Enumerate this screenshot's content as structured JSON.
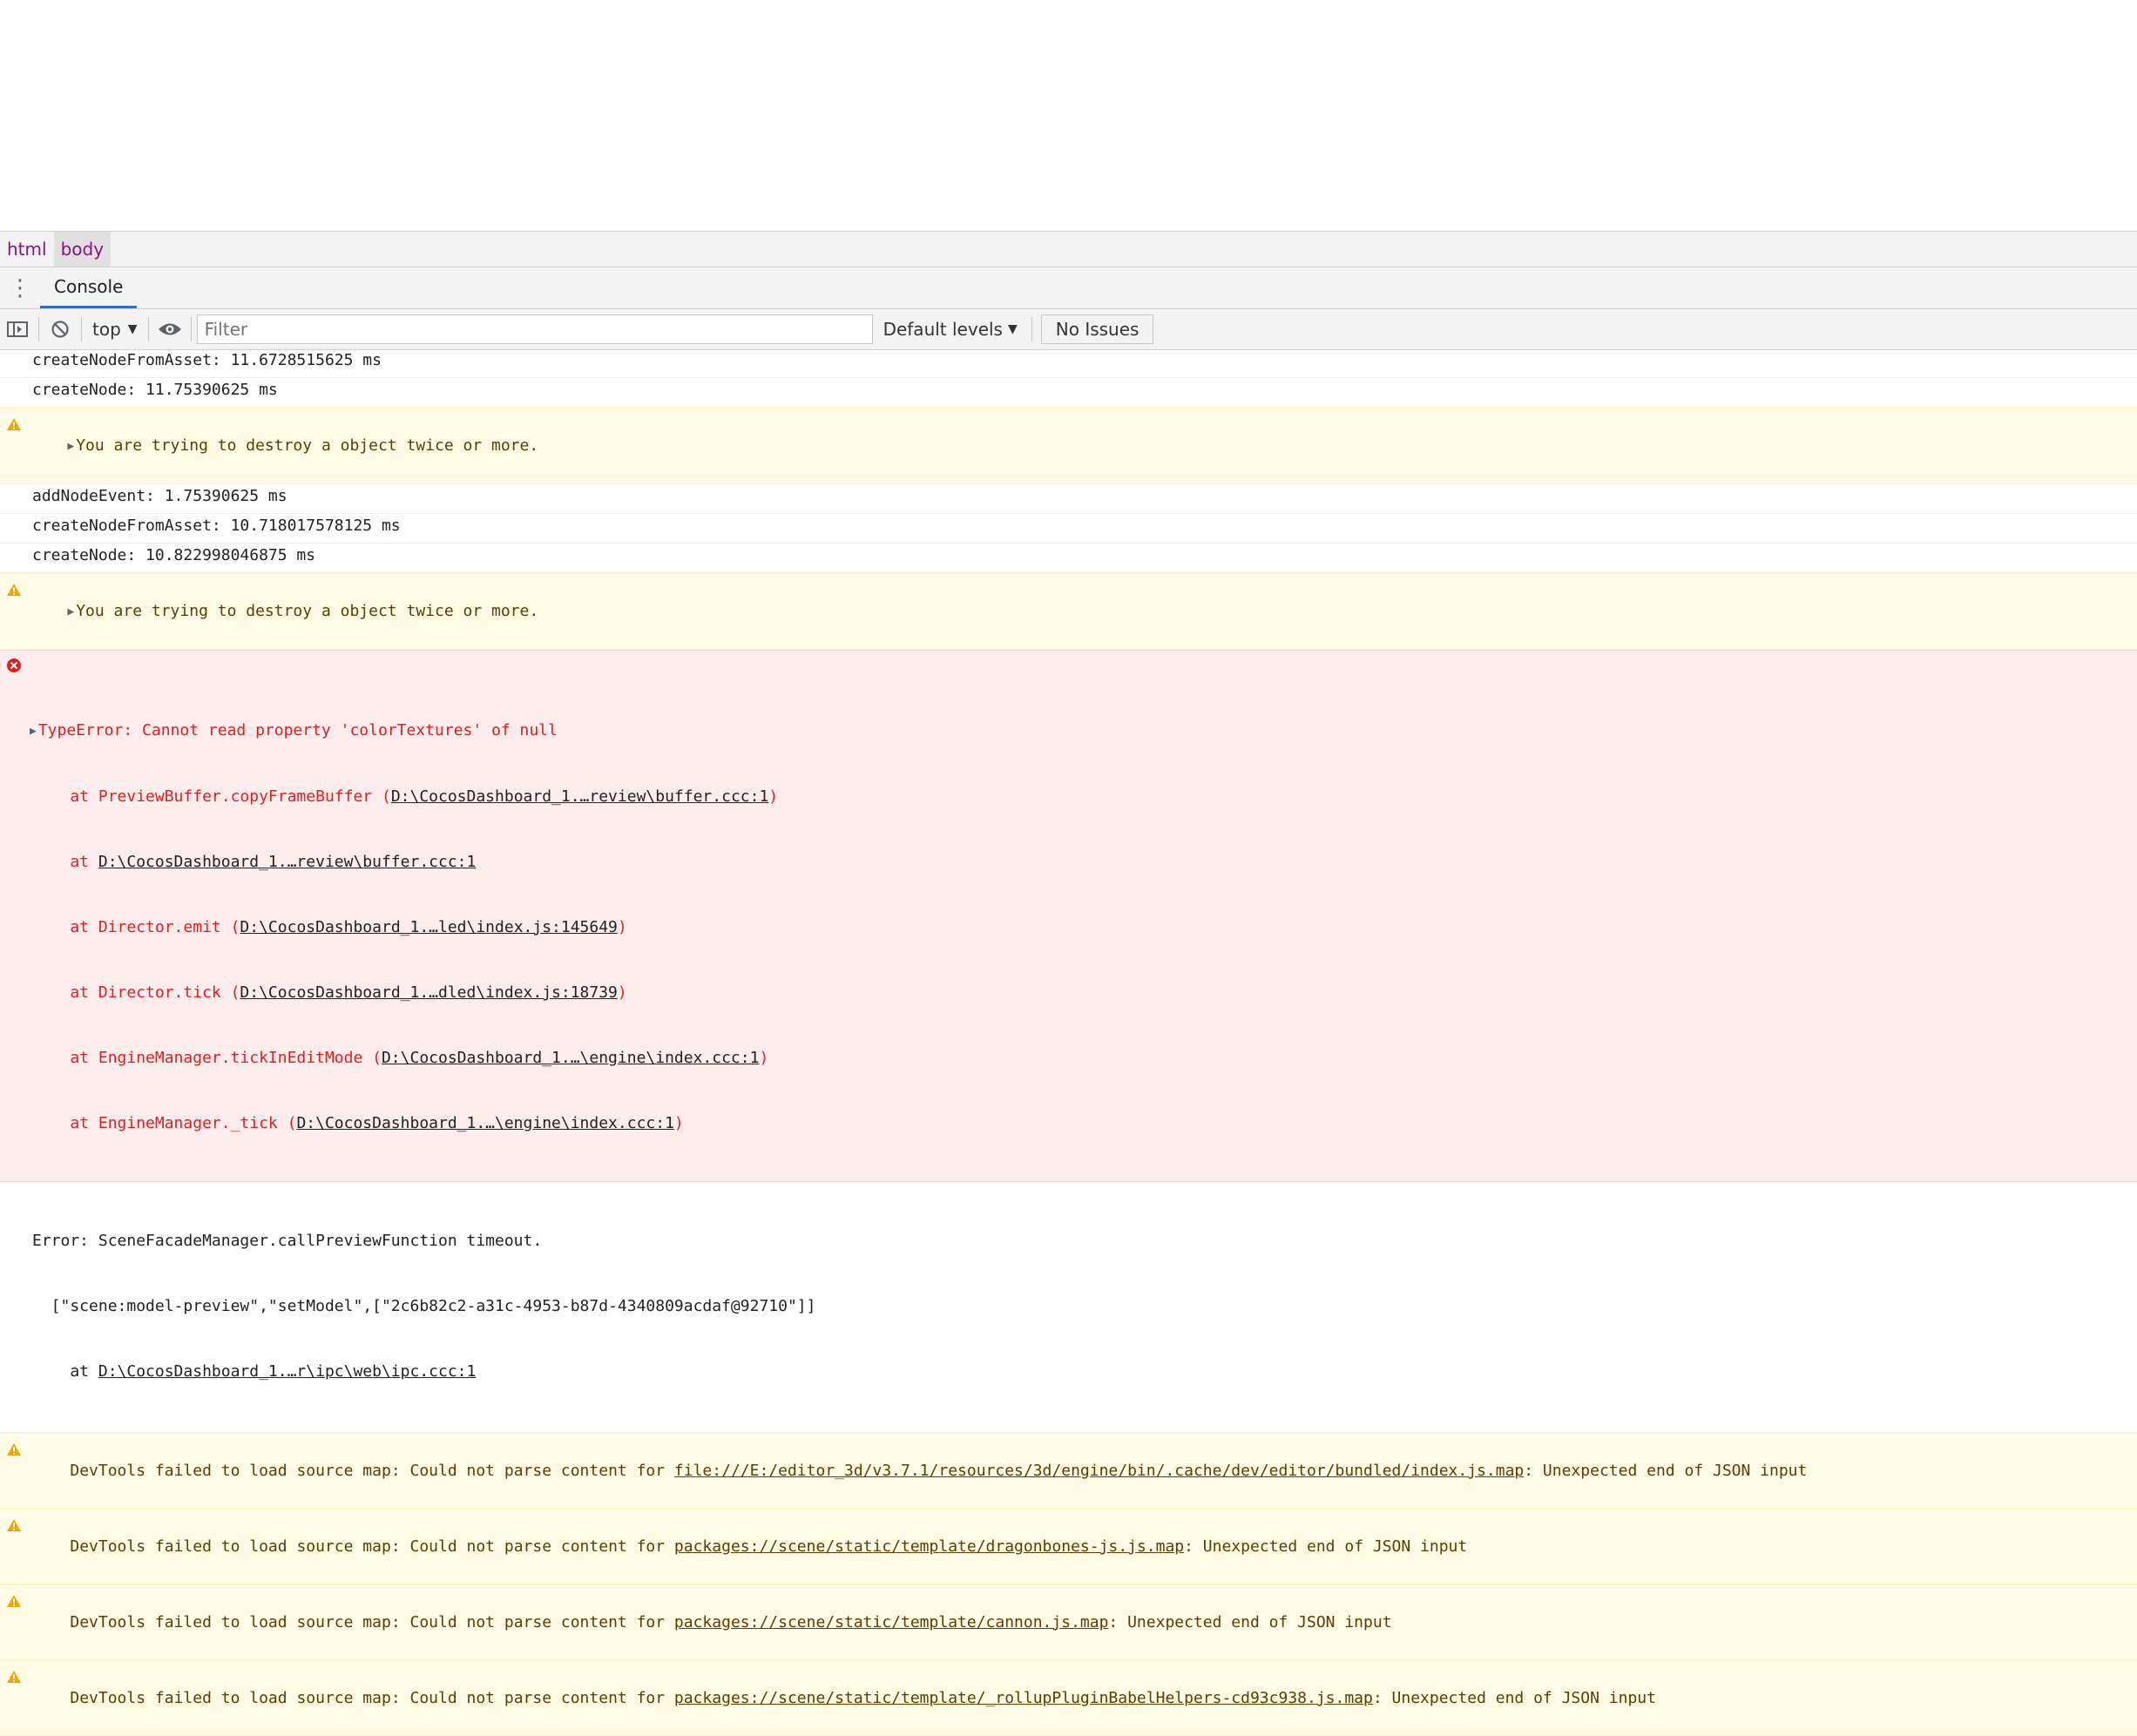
{
  "breadcrumb": [
    "html",
    "body"
  ],
  "drawer": {
    "tab": "Console"
  },
  "toolbar": {
    "context": "top",
    "filter_placeholder": "Filter",
    "levels": "Default levels",
    "issues": "No Issues"
  },
  "messages": [
    {
      "type": "log",
      "text": "createNodeFromAsset: 11.6728515625 ms"
    },
    {
      "type": "log",
      "text": "createNode: 11.75390625 ms"
    },
    {
      "type": "warn",
      "text": "You are trying to destroy a object twice or more."
    },
    {
      "type": "log",
      "text": "addNodeEvent: 1.75390625 ms"
    },
    {
      "type": "log",
      "text": "createNodeFromAsset: 10.718017578125 ms"
    },
    {
      "type": "log",
      "text": "createNode: 10.822998046875 ms"
    },
    {
      "type": "warn",
      "text": "You are trying to destroy a object twice or more."
    }
  ],
  "error": {
    "title": "TypeError: Cannot read property 'colorTextures' of null",
    "stack": [
      {
        "pre": "    at PreviewBuffer.copyFrameBuffer (",
        "link": "D:\\CocosDashboard_1.…review\\buffer.ccc:1",
        "post": ")"
      },
      {
        "pre": "    at ",
        "link": "D:\\CocosDashboard_1.…review\\buffer.ccc:1",
        "post": ""
      },
      {
        "pre": "    at Director.emit (",
        "link": "D:\\CocosDashboard_1.…led\\index.js:145649",
        "post": ")"
      },
      {
        "pre": "    at Director.tick (",
        "link": "D:\\CocosDashboard_1.…dled\\index.js:18739",
        "post": ")"
      },
      {
        "pre": "    at EngineManager.tickInEditMode (",
        "link": "D:\\CocosDashboard_1.…\\engine\\index.ccc:1",
        "post": ")"
      },
      {
        "pre": "    at EngineManager._tick (",
        "link": "D:\\CocosDashboard_1.…\\engine\\index.ccc:1",
        "post": ")"
      }
    ]
  },
  "timeout": {
    "line1": "Error: SceneFacadeManager.callPreviewFunction timeout.",
    "line2": "  [\"scene:model-preview\",\"setModel\",[\"2c6b82c2-a31c-4953-b87d-4340809acdaf@92710\"]]",
    "line3_pre": "    at ",
    "line3_link": "D:\\CocosDashboard_1.…r\\ipc\\web\\ipc.ccc:1"
  },
  "sourcemaps": [
    {
      "pre": "DevTools failed to load source map: Could not parse content for ",
      "link": "file:///E:/editor_3d/v3.7.1/resources/3d/engine/bin/.cache/dev/editor/bundled/index.js.map",
      "post": ": Unexpected end of JSON input"
    },
    {
      "pre": "DevTools failed to load source map: Could not parse content for ",
      "link": "packages://scene/static/template/dragonbones-js.js.map",
      "post": ": Unexpected end of JSON input"
    },
    {
      "pre": "DevTools failed to load source map: Could not parse content for ",
      "link": "packages://scene/static/template/cannon.js.map",
      "post": ": Unexpected end of JSON input"
    },
    {
      "pre": "DevTools failed to load source map: Could not parse content for ",
      "link": "packages://scene/static/template/_rollupPluginBabelHelpers-cd93c938.js.map",
      "post": ": Unexpected end of JSON input"
    }
  ],
  "colors": {
    "warn_bg": "#fffbe5",
    "error_bg": "#fcecec",
    "error_text": "#e41e1e",
    "accent": "#1a73e8",
    "dom_tag": "#881280"
  }
}
